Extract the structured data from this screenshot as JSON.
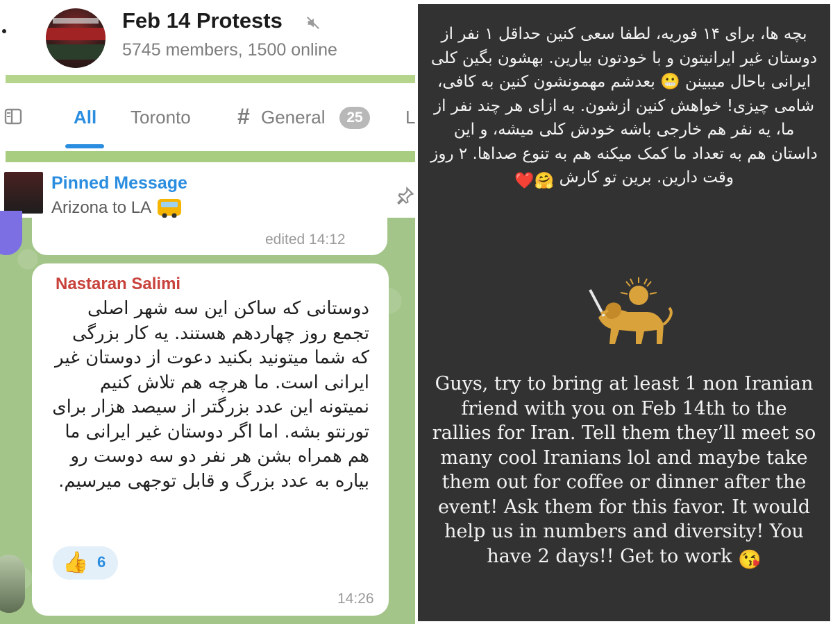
{
  "colors": {
    "accent": "#2a8de0",
    "sender": "#c8423b",
    "chat_bg": "#a4c58a",
    "story_bg": "#323232"
  },
  "header": {
    "title": "Feb 14 Protests",
    "subtitle": "5745 members, 1500 online",
    "mute_icon": "muted-speaker-icon"
  },
  "tabs": [
    {
      "label": "All",
      "active": true
    },
    {
      "label": "Toronto"
    },
    {
      "label": "General",
      "icon": "#",
      "badge": "25"
    },
    {
      "label": "L"
    }
  ],
  "pinned": {
    "title": "Pinned Message",
    "text": "Arizona to LA",
    "emoji": "bus-icon"
  },
  "previous_message": {
    "status": "edited 14:12"
  },
  "message": {
    "sender": "Nastaran Salimi",
    "text": "دوستانی که ساکن این سه شهر اصلی تجمع روز چهاردهم هستند. یه کار بزرگی که شما میتونید بکنید دعوت از دوستان غیر ایرانی است. ما هرچه هم تلاش کنیم نمیتونه این عدد بزرگتر از سیصد هزار برای تورنتو بشه. اما اگر دوستان غیر ایرانی ما هم همراه بشن هر نفر دو سه دوست رو بیاره به عدد بزرگ و قابل توجهی میرسیم.",
    "reaction_emoji": "thumbs-up-icon",
    "reaction_count": "6",
    "time": "14:26"
  },
  "story": {
    "persian_text": "بچه ها، برای ۱۴ فوریه، لطفا سعی کنین حداقل ۱ نفر از دوستان غیر ایرانیتون و با خودتون بیارین. بهشون بگین کلی ایرانی باحال میبینن 😬 بعدشم مهمونشون کنین به کافی، شامی چیزی! خواهش کنین ازشون. به ازای هر چند نفر از ما، یه نفر هم خارجی باشه خودش کلی میشه، و این داستان هم به تعداد ما کمک میکنه هم به تنوع صداها. ۲ روز وقت دارین. برین تو کارش",
    "persian_emojis": "🤗❤️",
    "emblem": "lion-and-sun-icon",
    "english_text": "Guys, try to bring at least 1 non Iranian friend with you on Feb 14th to the rallies for Iran. Tell them they’ll meet so many cool Iranians lol and maybe take them out for coffee or dinner after the event! Ask them for this favor. It would help us in numbers and diversity! You have 2 days!! Get to work",
    "english_emoji": "😘"
  }
}
